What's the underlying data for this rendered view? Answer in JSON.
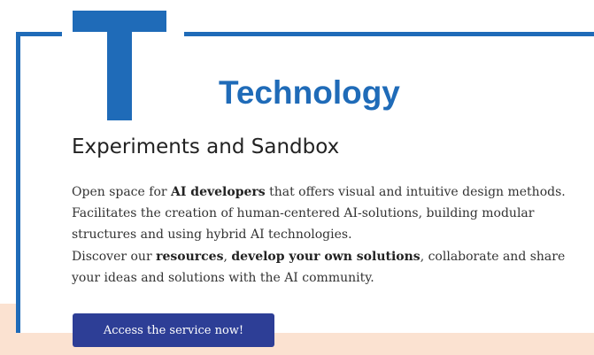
{
  "brand_color": "#1f6bb8",
  "button_color": "#2d3e96",
  "band_color": "#fbe2d1",
  "category": {
    "letter": "T",
    "title": "Technology"
  },
  "section": {
    "heading": "Experiments and Sandbox"
  },
  "paragraph1": {
    "part1": "Open space for ",
    "bold1": "AI developers",
    "part2": " that offers visual and intuitive design methods. Facilitates the creation of human-centered AI-solutions, building modular structures and using hybrid AI technologies."
  },
  "paragraph2": {
    "part1": "Discover our ",
    "bold1": "resources",
    "part2": ", ",
    "bold2": "develop your own solutions",
    "part3": ", collaborate and share your ideas and solutions with the AI community."
  },
  "cta": {
    "label": "Access the service now!"
  }
}
